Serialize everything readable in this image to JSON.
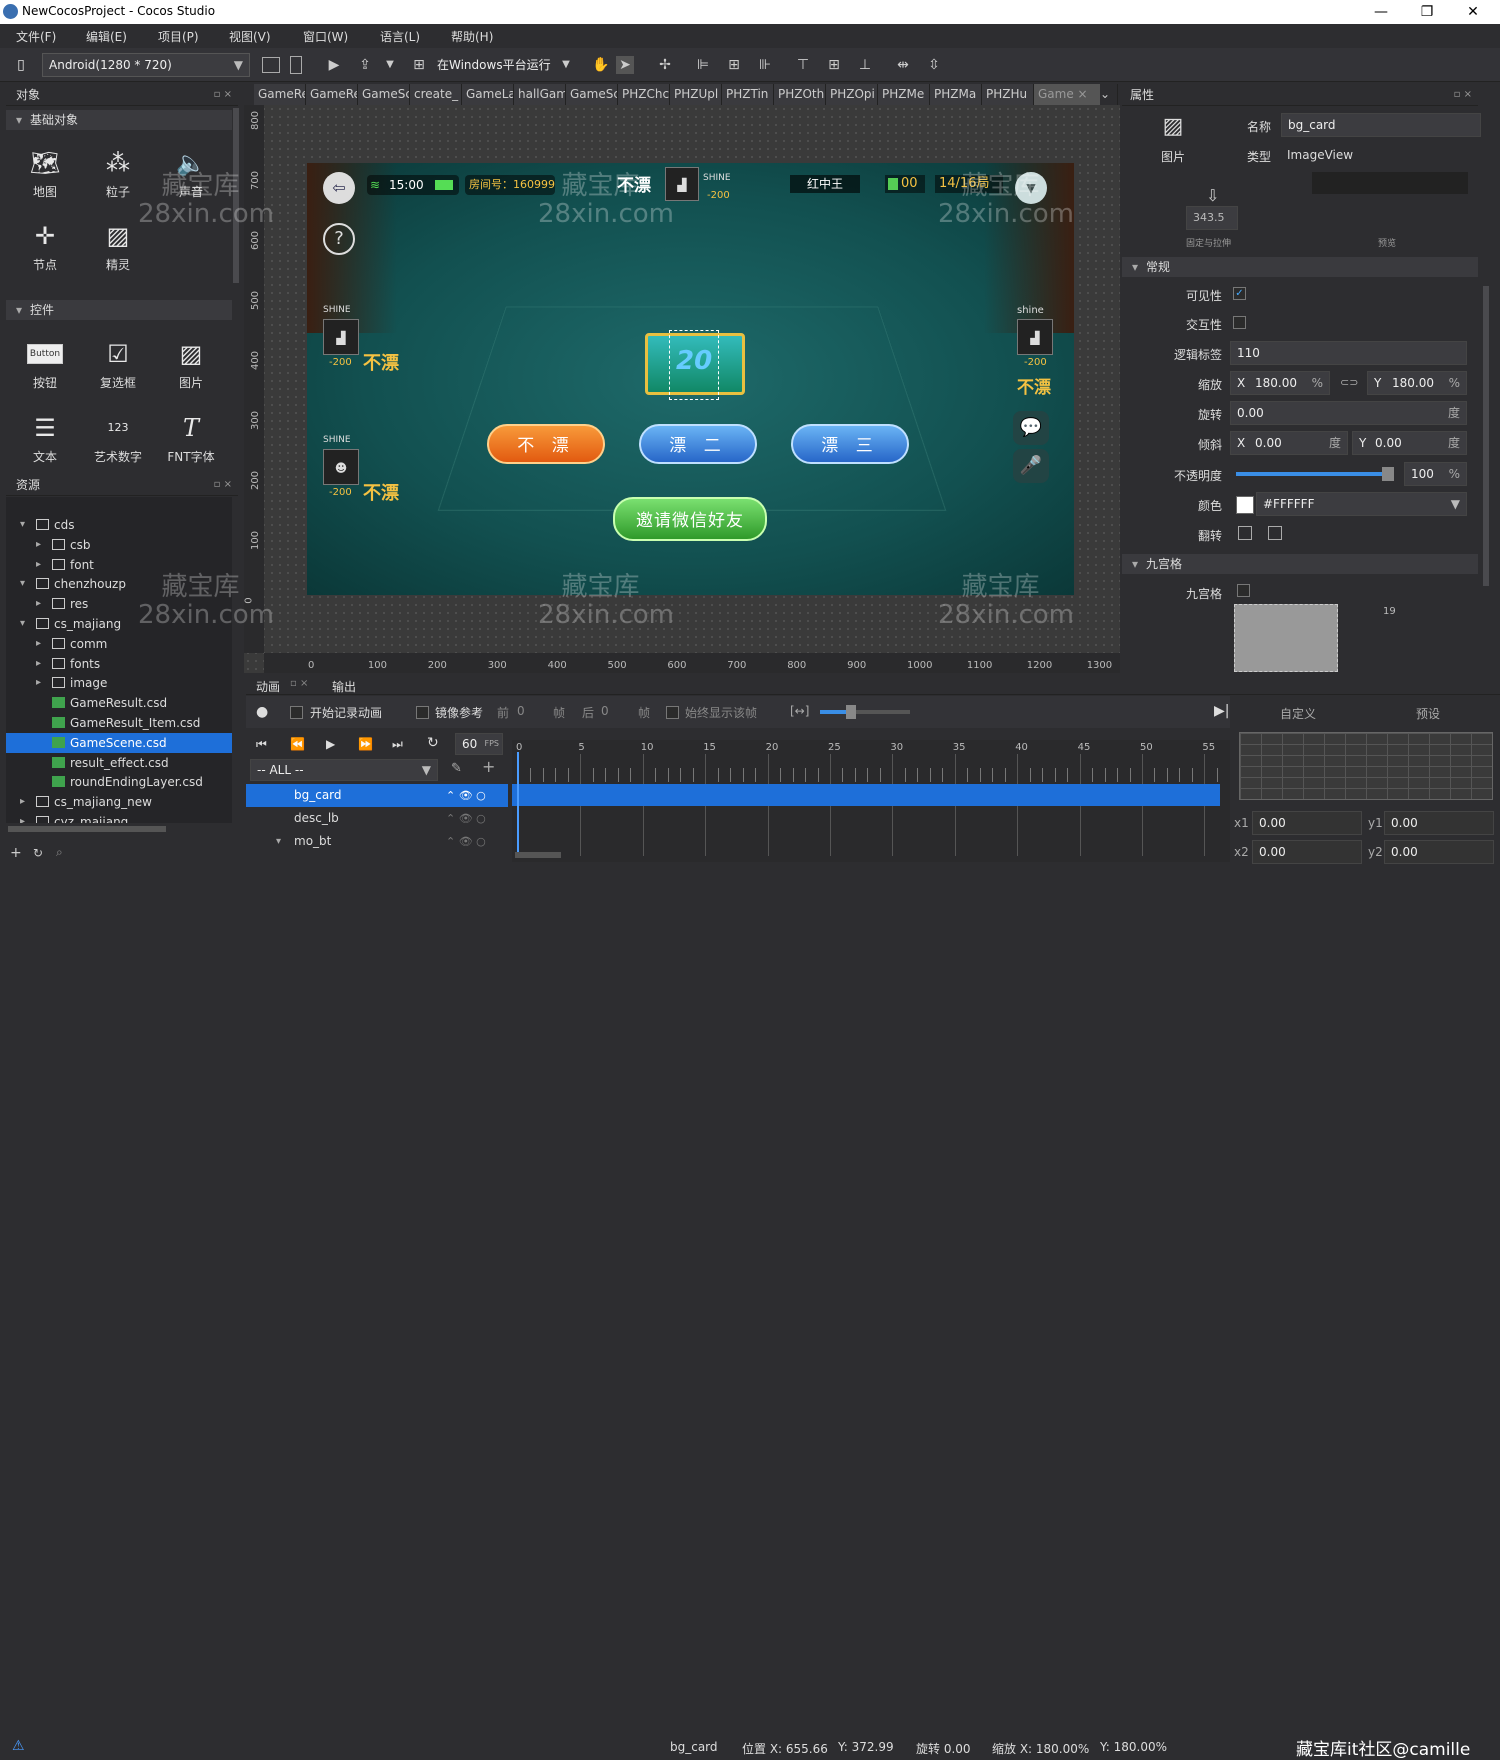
{
  "window": {
    "title": "NewCocosProject - Cocos Studio",
    "controls": [
      "—",
      "❐",
      "✕"
    ]
  },
  "menu": [
    "文件(F)",
    "编辑(E)",
    "项目(P)",
    "视图(V)",
    "窗口(W)",
    "语言(L)",
    "帮助(H)"
  ],
  "toolbar": {
    "resolution": "Android(1280 * 720)",
    "run_label": "在Windows平台运行"
  },
  "objects_panel": {
    "title": "对象",
    "cat_basic": "基础对象",
    "cat_controls": "控件",
    "basic": [
      {
        "label": "地图",
        "icon": "map-icon"
      },
      {
        "label": "粒子",
        "icon": "particle-icon"
      },
      {
        "label": "声音",
        "icon": "sound-icon"
      },
      {
        "label": "节点",
        "icon": "node-icon"
      },
      {
        "label": "精灵",
        "icon": "sprite-icon"
      }
    ],
    "controls": [
      {
        "label": "按钮",
        "icon": "button-icon"
      },
      {
        "label": "复选框",
        "icon": "checkbox-icon"
      },
      {
        "label": "图片",
        "icon": "image-icon"
      },
      {
        "label": "文本",
        "icon": "text-icon"
      },
      {
        "label": "艺术数字",
        "icon": "atlas-icon"
      },
      {
        "label": "FNT字体",
        "icon": "fnt-icon"
      }
    ],
    "button_icon_text": "Button",
    "atlas_icon_text": "123"
  },
  "resources_panel": {
    "title": "资源",
    "items": [
      {
        "label": "cds",
        "level": 0,
        "type": "folder",
        "open": true
      },
      {
        "label": "csb",
        "level": 1,
        "type": "folder",
        "open": false
      },
      {
        "label": "font",
        "level": 1,
        "type": "folder",
        "open": false
      },
      {
        "label": "chenzhouzp",
        "level": 0,
        "type": "folder",
        "open": true
      },
      {
        "label": "res",
        "level": 1,
        "type": "folder",
        "open": false
      },
      {
        "label": "cs_majiang",
        "level": 0,
        "type": "folder",
        "open": true
      },
      {
        "label": "comm",
        "level": 1,
        "type": "folder",
        "open": false
      },
      {
        "label": "fonts",
        "level": 1,
        "type": "folder",
        "open": false
      },
      {
        "label": "image",
        "level": 1,
        "type": "folder",
        "open": false
      },
      {
        "label": "GameResult.csd",
        "level": 1,
        "type": "file"
      },
      {
        "label": "GameResult_Item.csd",
        "level": 1,
        "type": "file"
      },
      {
        "label": "GameScene.csd",
        "level": 1,
        "type": "file",
        "selected": true
      },
      {
        "label": "result_effect.csd",
        "level": 1,
        "type": "file"
      },
      {
        "label": "roundEndingLayer.csd",
        "level": 1,
        "type": "file"
      },
      {
        "label": "cs_majiang_new",
        "level": 0,
        "type": "folder",
        "open": false
      },
      {
        "label": "cyz_majiang",
        "level": 0,
        "type": "folder",
        "open": false
      }
    ]
  },
  "tabs": [
    "GameRe",
    "GameRe",
    "GameSc",
    "create_",
    "GameLa",
    "hallGam",
    "GameSc",
    "PHZChc",
    "PHZUpl",
    "PHZTin",
    "PHZOth",
    "PHZOpi",
    "PHZMe",
    "PHZMa",
    "PHZHu",
    "Game"
  ],
  "ruler": {
    "x": [
      "0",
      "100",
      "200",
      "300",
      "400",
      "500",
      "600",
      "700",
      "800",
      "900",
      "1000",
      "1100",
      "1200",
      "1300"
    ],
    "y": [
      "800",
      "700",
      "600",
      "500",
      "400",
      "300",
      "200",
      "100",
      "0"
    ]
  },
  "game": {
    "time": "15:00",
    "room": "房间号：160999",
    "mode": "红中王",
    "coins": "00",
    "round": "14/16局",
    "center_num": "20",
    "top_player": {
      "name": "SHINE",
      "score": "-200",
      "status": "不漂"
    },
    "left1": {
      "name": "SHINE",
      "score": "-200",
      "status": "不漂"
    },
    "left2": {
      "name": "SHINE",
      "score": "-200",
      "status": "不漂"
    },
    "right": {
      "name": "shine",
      "score": "-200",
      "status": "不漂"
    },
    "btn_no": "不 漂",
    "btn_two": "漂 二",
    "btn_three": "漂 三",
    "invite": "邀请微信好友"
  },
  "watermark": {
    "line1": "藏宝库",
    "line2": "28xin.com"
  },
  "properties": {
    "title": "属性",
    "thumb_label": "图片",
    "name_label": "名称",
    "name_value": "bg_card",
    "type_label": "类型",
    "type_value": "ImageView",
    "anchor_value": "343.5",
    "anchor_label": "固定与拉伸",
    "preview_label": "预览",
    "section_general": "常规",
    "visible": "可见性",
    "interactive": "交互性",
    "tag_label": "逻辑标签",
    "tag_value": "110",
    "scale_label": "缩放",
    "scale_x": "180.00",
    "scale_y": "180.00",
    "rotation_label": "旋转",
    "rotation_value": "0.00",
    "skew_label": "倾斜",
    "skew_x": "0.00",
    "skew_y": "0.00",
    "opacity_label": "不透明度",
    "opacity_value": "100",
    "opacity": 1.0,
    "color_label": "颜色",
    "color_value": "#FFFFFF",
    "flip_label": "翻转",
    "section_nine": "九宫格",
    "nine_label": "九宫格",
    "x_tag": "X",
    "y_tag": "Y",
    "pct": "%",
    "deg": "度",
    "nine_num": "19"
  },
  "timeline": {
    "tab_anim": "动画",
    "tab_output": "输出",
    "record": "开始记录动画",
    "mirror": "镜像参考",
    "before": "前",
    "before_val": "0",
    "frame": "帧",
    "after": "后",
    "after_val": "0",
    "always": "始终显示该帧",
    "fps": "60",
    "fps_unit": "FPS",
    "filter": "-- ALL --",
    "rows": [
      "bg_card",
      "desc_lb",
      "mo_bt"
    ],
    "ticks": [
      "0",
      "5",
      "10",
      "15",
      "20",
      "25",
      "30",
      "35",
      "40",
      "45",
      "50",
      "55"
    ],
    "custom": "自定义",
    "preset": "预设",
    "x1": "0.00",
    "y1": "0.00",
    "x2": "0.00",
    "y2": "0.00"
  },
  "status": {
    "name": "bg_card",
    "pos": "位置 X: 655.66",
    "pos_y": "Y: 372.99",
    "rot": "旋转 0.00",
    "scale": "缩放 X: 180.00%",
    "scale_y": "Y: 180.00%",
    "brand": "藏宝库it社区@camille"
  }
}
